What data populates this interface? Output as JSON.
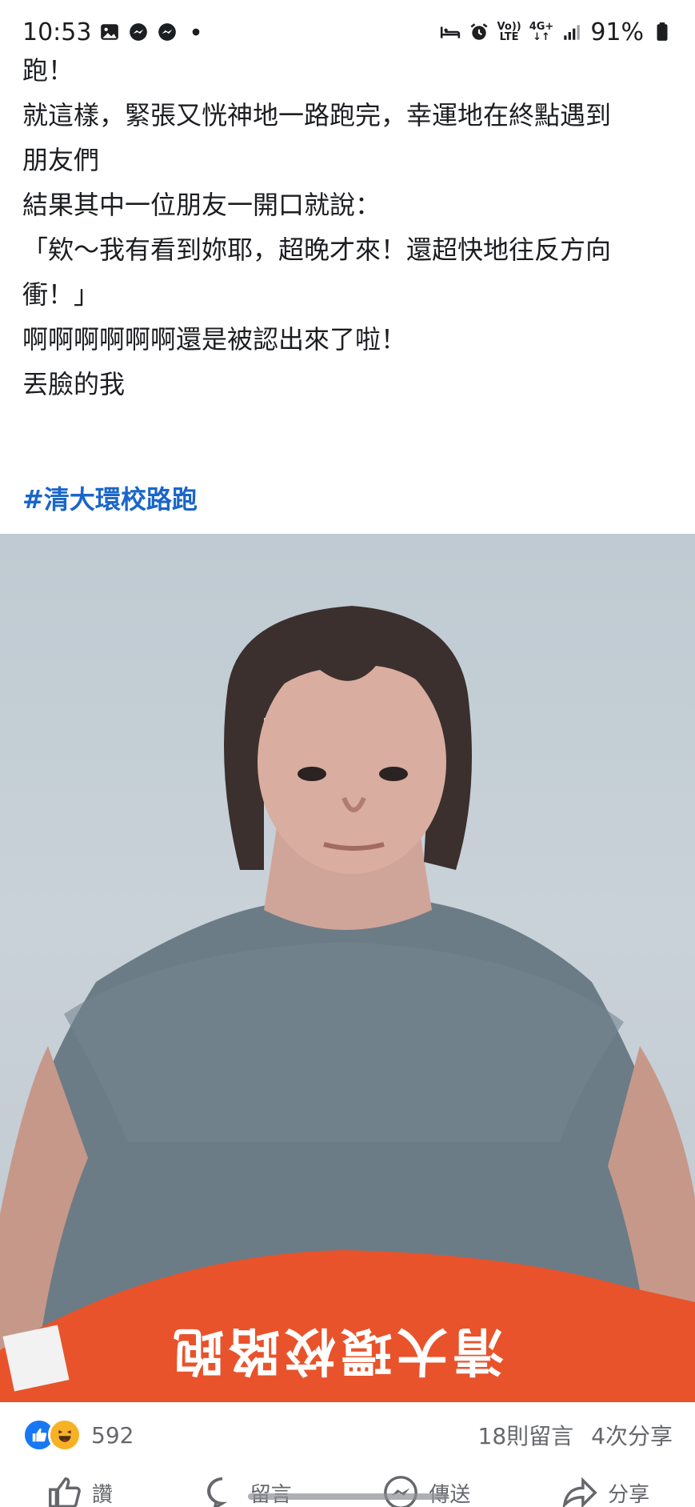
{
  "status_bar": {
    "time": "10:53",
    "left_icons": [
      "gallery-icon",
      "messenger-icon",
      "messenger-icon",
      "dot-icon"
    ],
    "volte_top": "Vo))",
    "volte_bottom": "LTE",
    "network": "4G+",
    "battery": "91%"
  },
  "post": {
    "lines": [
      "跑！",
      "",
      "就這樣，緊張又恍神地一路跑完，幸運地在終點遇到",
      "朋友們",
      "結果其中一位朋友一開口就說：",
      "「欸～我有看到妳耶，超晚才來！還超快地往反方向",
      "衝！」",
      "啊啊啊啊啊啊還是被認出來了啦！",
      "丟臉的我"
    ],
    "hashtag": "#清大環校路跑",
    "photo_bib_text": "清大環校路跑"
  },
  "reactions": {
    "count": "592",
    "comments": "18則留言",
    "shares": "4次分享",
    "icons": [
      "like-icon",
      "haha-icon"
    ],
    "colors": {
      "like": "#1877f2",
      "haha": "#f7b125",
      "hashtag": "#1a66c8"
    }
  },
  "actions": {
    "like": "讚",
    "comment": "留言",
    "send": "傳送",
    "share": "分享"
  }
}
